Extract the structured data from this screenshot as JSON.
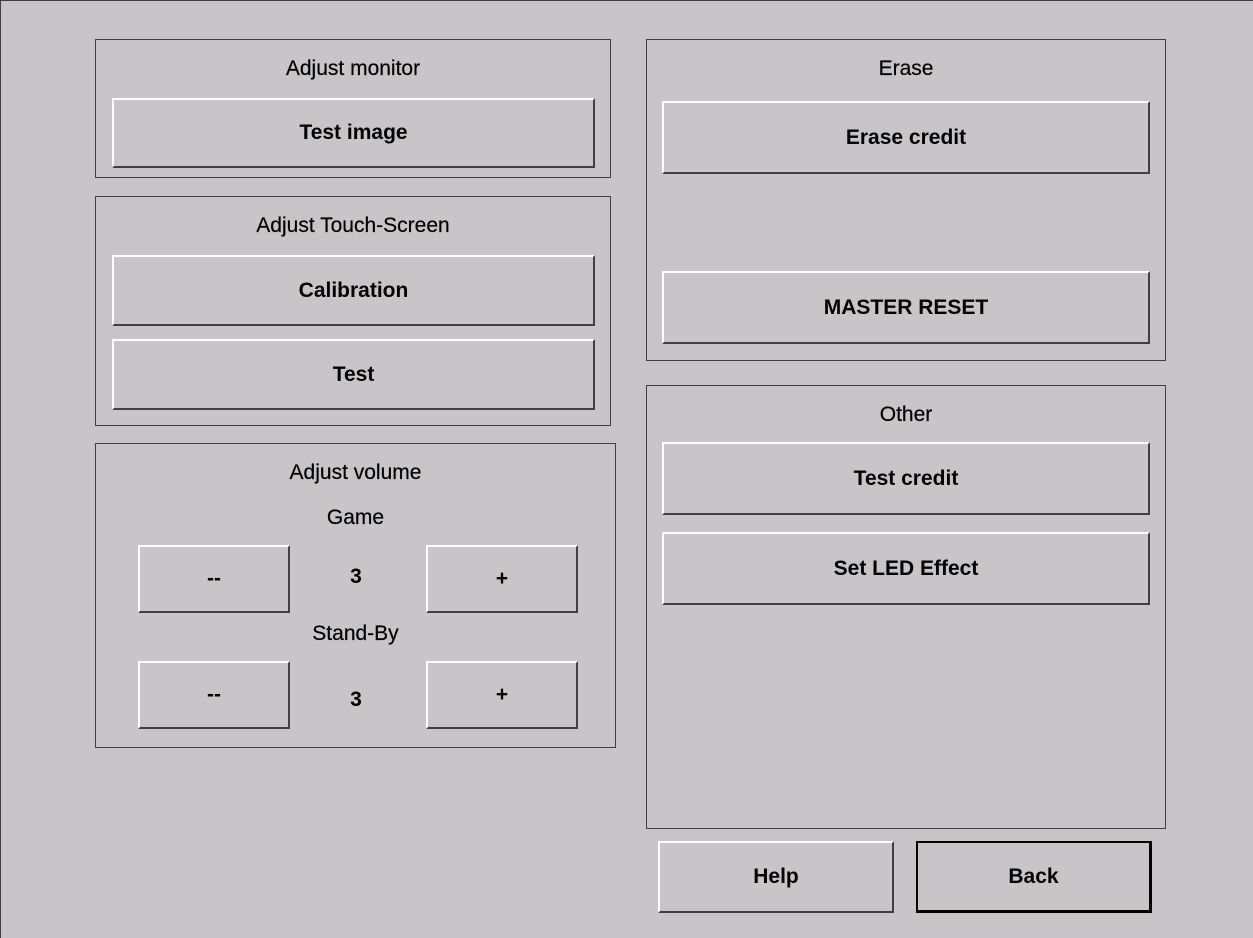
{
  "monitor": {
    "title": "Adjust monitor",
    "test_image_label": "Test image"
  },
  "touchscreen": {
    "title": "Adjust Touch-Screen",
    "calibration_label": "Calibration",
    "test_label": "Test"
  },
  "volume": {
    "title": "Adjust volume",
    "game": {
      "label": "Game",
      "decrease_label": "--",
      "value": "3",
      "increase_label": "+"
    },
    "standby": {
      "label": "Stand-By",
      "decrease_label": "--",
      "value": "3",
      "increase_label": "+"
    }
  },
  "erase": {
    "title": "Erase",
    "erase_credit_label": "Erase credit",
    "master_reset_label": "MASTER RESET"
  },
  "other": {
    "title": "Other",
    "test_credit_label": "Test credit",
    "set_led_label": "Set LED Effect"
  },
  "footer": {
    "help_label": "Help",
    "back_label": "Back"
  },
  "colors": {
    "background": "#c8c4c8",
    "border_dark": "#404040",
    "highlight": "#ffffff"
  }
}
